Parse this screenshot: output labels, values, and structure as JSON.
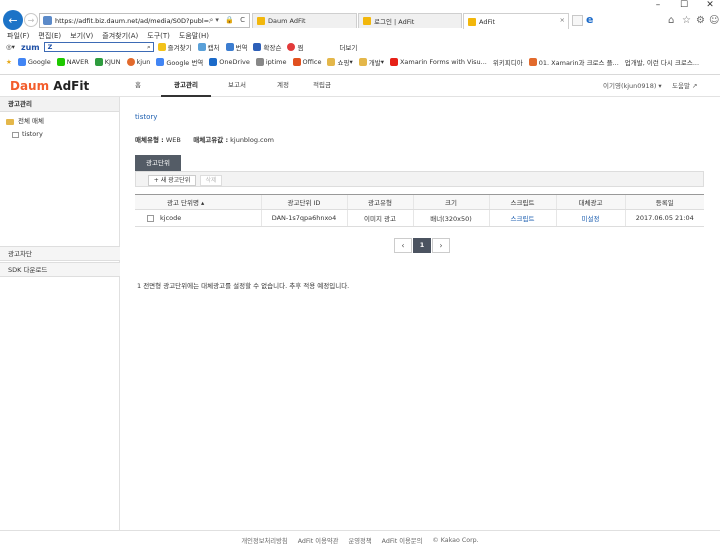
{
  "browser": {
    "address": "https://adfit.biz.daum.net/ad/media/S0D?publ=xid=3y",
    "tabs": [
      {
        "label": "Daum AdFit"
      },
      {
        "label": "로그인 | AdFit"
      },
      {
        "label": "AdFit"
      }
    ],
    "menu": [
      "파일(F)",
      "편집(E)",
      "보기(V)",
      "즐겨찾기(A)",
      "도구(T)",
      "도움말(H)"
    ],
    "toolbar": {
      "zum": "zum",
      "search_value": "Z",
      "items": [
        "즐겨찾기",
        "캡처",
        "번역",
        "확장슨",
        "찜",
        "더보기"
      ]
    },
    "favorites": [
      "Google",
      "NAVER",
      "KJUN",
      "kjun",
      "Google 번역",
      "OneDrive",
      "iptime",
      "Office",
      "쇼핑",
      "개발",
      "Xamarin Forms with Visu...",
      "위키피디아",
      "01. Xamarin과 크로스 플...",
      "업개발, 이런 다시 크로스..."
    ]
  },
  "header": {
    "logo_daum": "Daum",
    "logo_adfit": "AdFit",
    "nav": [
      "홈",
      "광고관리",
      "보고서",
      "계정",
      "적립금"
    ],
    "user": "이기영(kjun0918) ▾",
    "help": "도움말 ↗"
  },
  "sidebar": {
    "title": "광고관리",
    "tree": [
      "전체 매체",
      "tistory"
    ],
    "sections": [
      "광고차단",
      "SDK 다운로드"
    ]
  },
  "main": {
    "site": "tistory",
    "media_type_label": "매체유형 :",
    "media_type": "WEB",
    "media_value_label": "매체고유값 :",
    "media_value": "kjunblog.com",
    "unit_tab": "광고단위",
    "new_unit_button": "+ 새 광고단위",
    "delete_button": "삭제",
    "table": {
      "headers": [
        "광고 단위명 ▴",
        "광고단위 ID",
        "광고유형",
        "크기",
        "스크립트",
        "대체광고",
        "등록일"
      ],
      "rows": [
        [
          "kjcode",
          "DAN-1s7qpa6hnxo4",
          "이미지 광고",
          "배너(320x50)",
          "스크립트",
          "미설정",
          "2017.06.05 21:04"
        ]
      ]
    },
    "pager": {
      "prev": "‹",
      "current": "1",
      "next": "›"
    },
    "note": "1  전면형 광고단위에는 대체광고를 설정할 수 없습니다. 추후 적용 예정입니다."
  },
  "footer": [
    "개인정보처리방침",
    "AdFit 이용약관",
    "운영정책",
    "AdFit 이용문의",
    "© Kakao Corp."
  ]
}
